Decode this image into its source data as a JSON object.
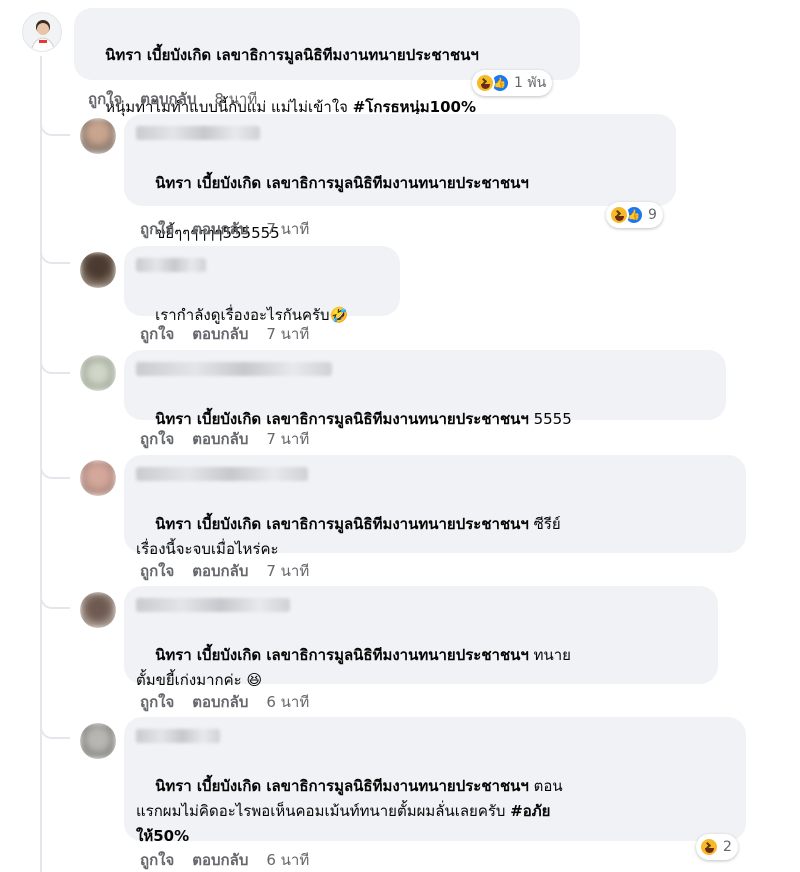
{
  "main_comment": {
    "author": "นิทรา เบี้ยบังเกิด เลขาธิการมูลนิธิทีมงานทนายประชาชนฯ",
    "text": "หนุ่มทำไมทำแบบนี้กับแม่ แม่ไม่เข้าใจ ",
    "hashtag": "#โกรธหนุ่ม100%",
    "reaction_count": "1 พัน",
    "like_label": "ถูกใจ",
    "reply_label": "ตอบกลับ",
    "time": "8 นาที"
  },
  "replies": [
    {
      "mention": "นิทรา เบี้ยบังเกิด เลขาธิการมูลนิธิทีมงานทนายประชาชนฯ",
      "text": "ขยี้ๆๆๆๆๆๆ555555",
      "reaction_count": "9",
      "like_label": "ถูกใจ",
      "reply_label": "ตอบกลับ",
      "time": "7 นาที"
    },
    {
      "mention": "",
      "text": "เรากำลังดูเรื่องอะไรกันครับ🤣",
      "like_label": "ถูกใจ",
      "reply_label": "ตอบกลับ",
      "time": "7 นาที"
    },
    {
      "mention": "นิทรา เบี้ยบังเกิด เลขาธิการมูลนิธิทีมงานทนายประชาชนฯ",
      "text": " 5555",
      "like_label": "ถูกใจ",
      "reply_label": "ตอบกลับ",
      "time": "7 นาที"
    },
    {
      "mention": "นิทรา เบี้ยบังเกิด เลขาธิการมูลนิธิทีมงานทนายประชาชนฯ",
      "text": " ซีรีย์\nเรื่องนี้จะจบเมื่อไหร่คะ",
      "like_label": "ถูกใจ",
      "reply_label": "ตอบกลับ",
      "time": "7 นาที"
    },
    {
      "mention": "นิทรา เบี้ยบังเกิด เลขาธิการมูลนิธิทีมงานทนายประชาชนฯ",
      "text": " ทนาย\nตั้มขยี้เก่งมากค่ะ 😆",
      "like_label": "ถูกใจ",
      "reply_label": "ตอบกลับ",
      "time": "6 นาที"
    },
    {
      "mention": "นิทรา เบี้ยบังเกิด เลขาธิการมูลนิธิทีมงานทนายประชาชนฯ",
      "text": " ตอน\nแรกผมไม่คิดอะไรพอเห็นคอมเม้นท์ทนายตั้มผมลั่นเลยครับ ",
      "hashtag": "#อภัย\nให้50%",
      "reaction_count": "2",
      "like_label": "ถูกใจ",
      "reply_label": "ตอบกลับ",
      "time": "6 นาที"
    }
  ],
  "colors": {
    "bubble": "#f0f2f5",
    "meta_text": "#65676b",
    "haha": "#f7b928",
    "like": "#1877f2"
  },
  "icons": {
    "haha": "haha-reaction-icon",
    "like": "like-reaction-icon"
  }
}
